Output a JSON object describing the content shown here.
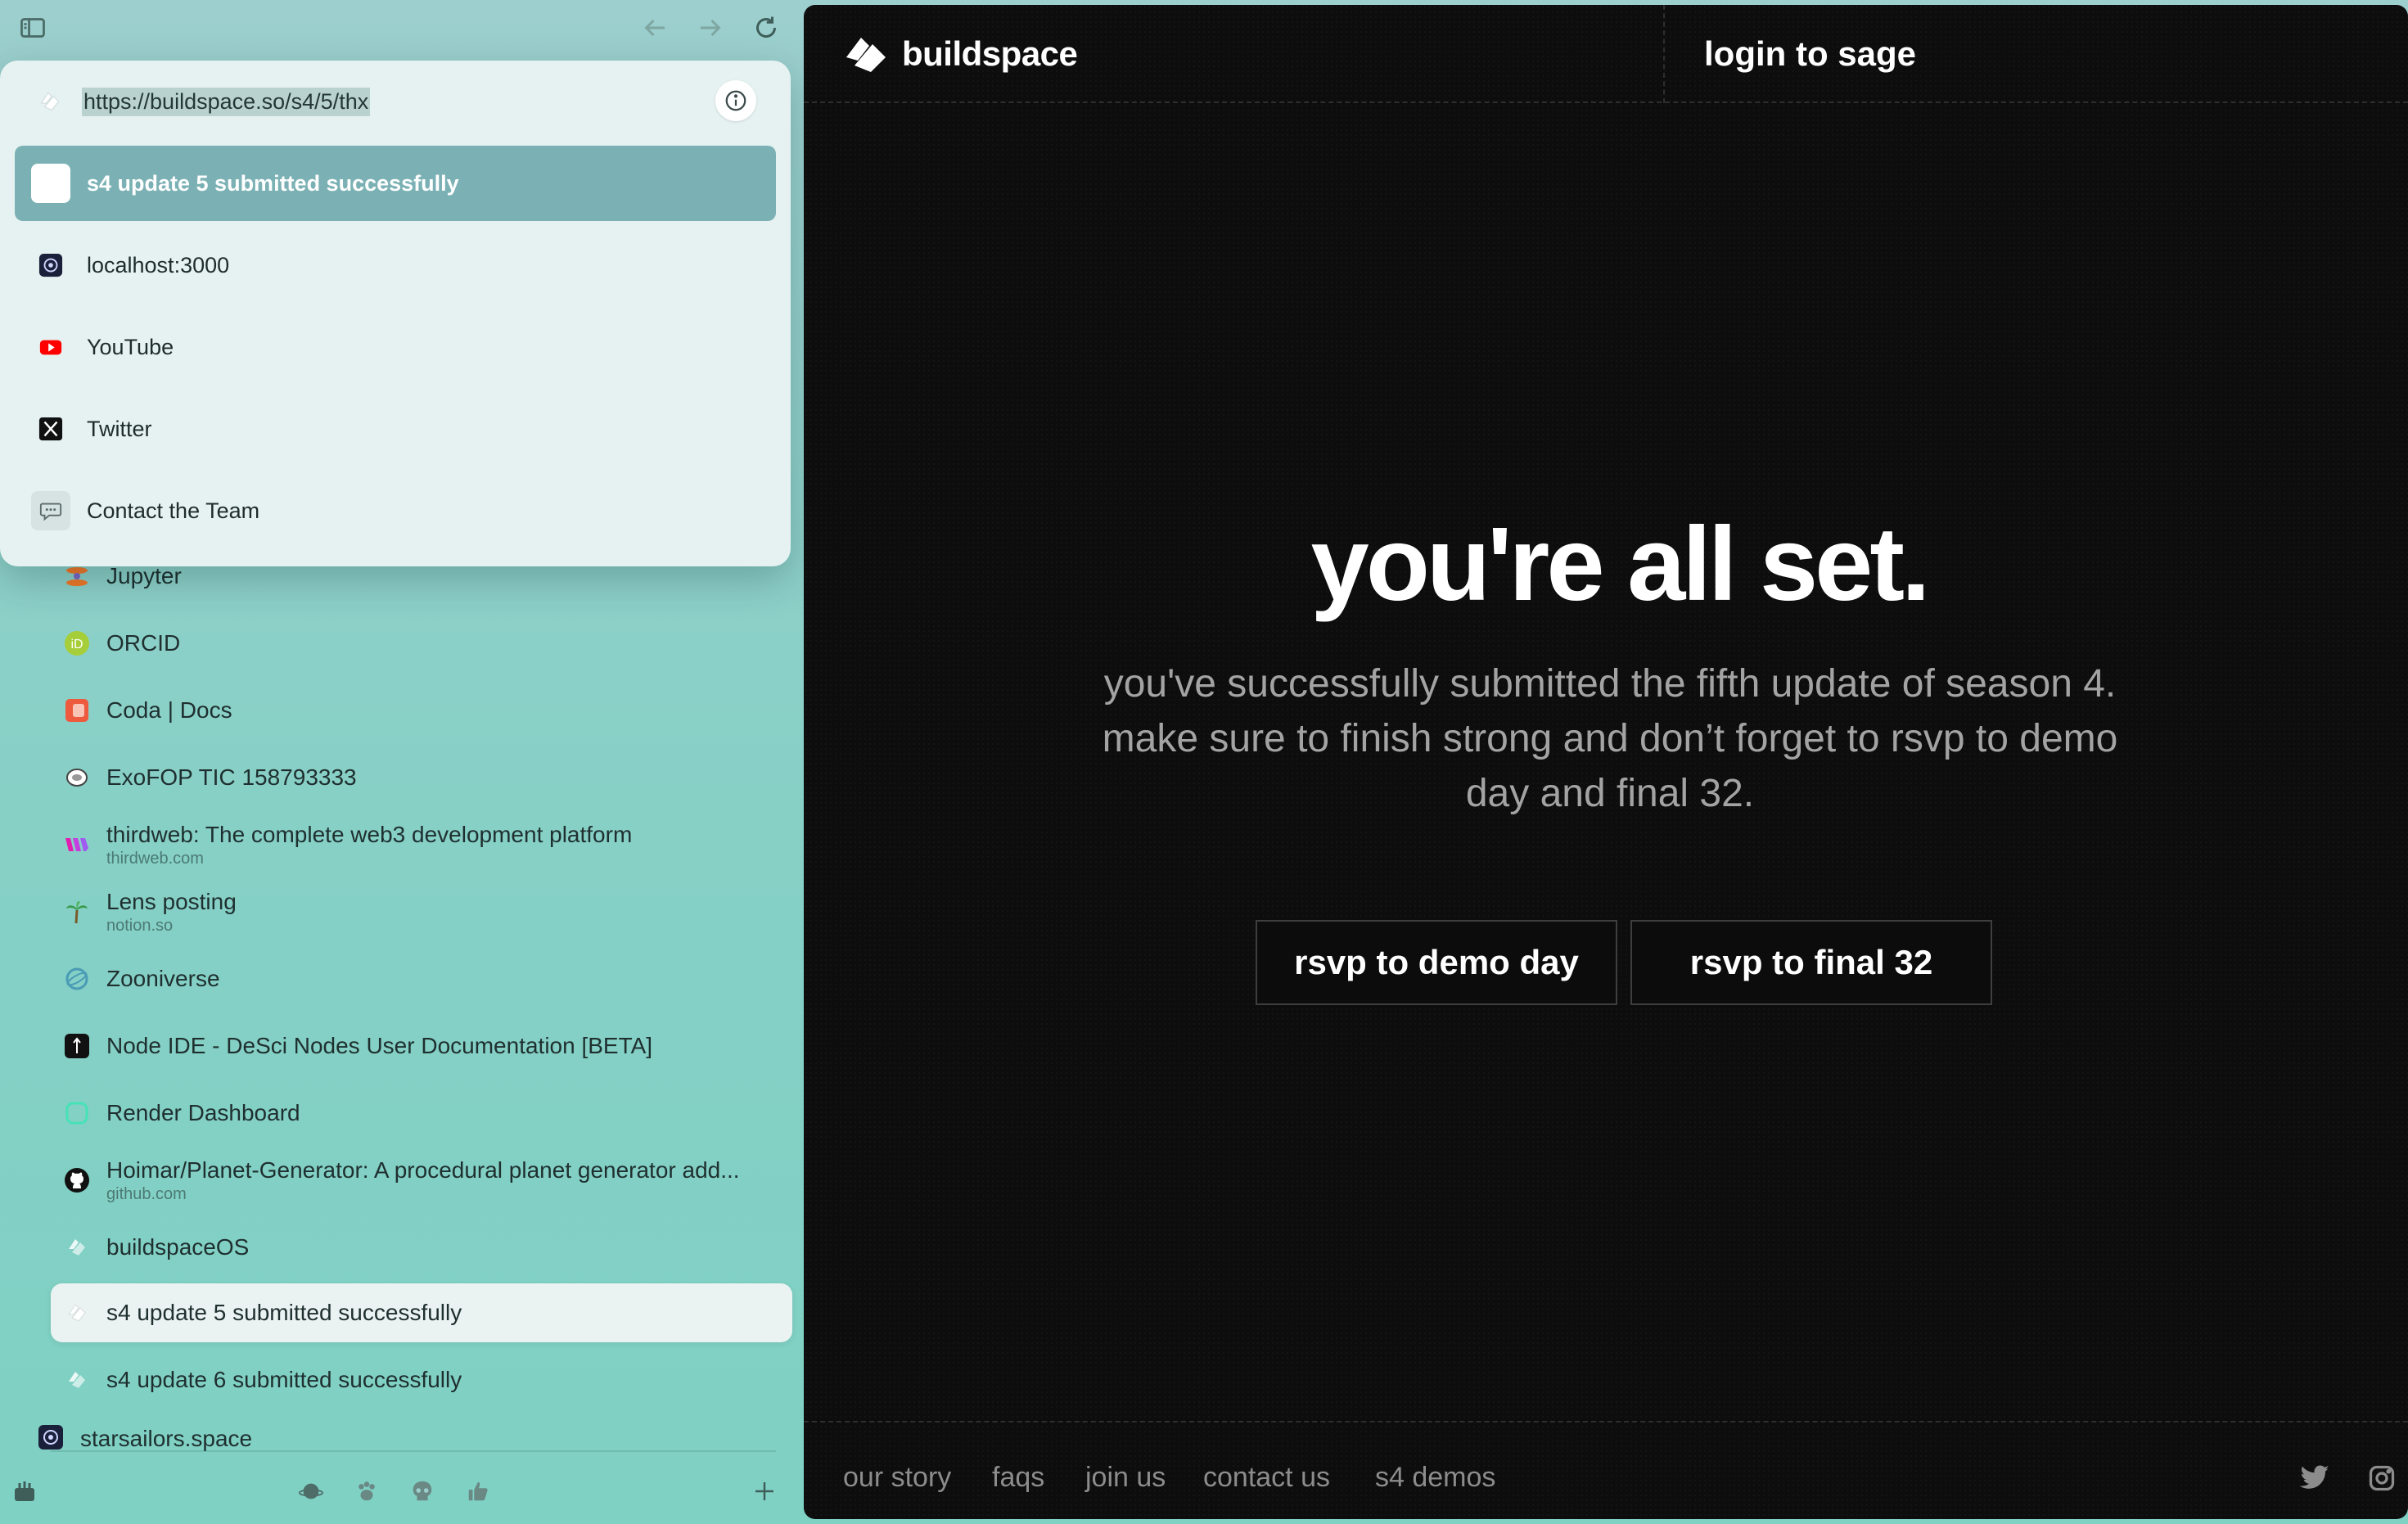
{
  "sidebar": {
    "tabs": [
      {
        "title": "Jupyter",
        "subtitle": "",
        "icon": "jupyter-icon"
      },
      {
        "title": "ORCID",
        "subtitle": "",
        "icon": "orcid-icon"
      },
      {
        "title": "Coda | Docs",
        "subtitle": "",
        "icon": "coda-icon"
      },
      {
        "title": "ExoFOP TIC 158793333",
        "subtitle": "",
        "icon": "exofop-icon"
      },
      {
        "title": "thirdweb: The complete web3 development platform",
        "subtitle": "thirdweb.com",
        "icon": "thirdweb-icon"
      },
      {
        "title": "Lens posting",
        "subtitle": "notion.so",
        "icon": "palm-tree-icon"
      },
      {
        "title": "Zooniverse",
        "subtitle": "",
        "icon": "zooniverse-icon"
      },
      {
        "title": "Node IDE - DeSci Nodes User Documentation [BETA]",
        "subtitle": "",
        "icon": "desci-icon"
      },
      {
        "title": "Render Dashboard",
        "subtitle": "",
        "icon": "render-icon"
      },
      {
        "title": "Hoimar/Planet-Generator: A procedural planet generator add...",
        "subtitle": "github.com",
        "icon": "github-icon"
      },
      {
        "title": "buildspaceOS",
        "subtitle": "",
        "icon": "buildspace-icon"
      },
      {
        "title": "s4 update 5 submitted successfully",
        "subtitle": "",
        "icon": "buildspace-icon"
      },
      {
        "title": "s4 update 6 submitted successfully",
        "subtitle": "",
        "icon": "buildspace-icon"
      },
      {
        "title": "starsailors.space",
        "subtitle": "",
        "icon": "starsailors-icon"
      }
    ]
  },
  "popup": {
    "url": "https://buildspace.so/s4/5/thx",
    "suggestions": [
      {
        "label": "s4 update 5 submitted successfully",
        "icon": "blank-page-icon"
      },
      {
        "label": "localhost:3000",
        "icon": "starsailors-icon"
      },
      {
        "label": "YouTube",
        "icon": "youtube-icon"
      },
      {
        "label": "Twitter",
        "icon": "x-icon"
      },
      {
        "label": "Contact the Team",
        "icon": "chat-bubble-icon"
      }
    ]
  },
  "page": {
    "brand": "buildspace",
    "login": "login to sage",
    "title": "you're all set.",
    "subtitle": "you've successfully submitted the fifth update of season 4. make sure to finish strong and don’t forget to rsvp to demo day and final 32.",
    "cta_demo": "rsvp to demo day",
    "cta_final": "rsvp to final 32",
    "footer": {
      "our_story": "our story",
      "faqs": "faqs",
      "join_us": "join us",
      "contact_us": "contact us",
      "s4_demos": "s4 demos"
    }
  },
  "colors": {
    "sidebar_bg": "#8fd0c9",
    "popup_bg": "#e6f2f1",
    "selected_suggestion": "#7bb1b4",
    "content_bg": "#0d0d0d",
    "hero_text": "#ffffff",
    "hero_sub": "#a3a3a3"
  }
}
